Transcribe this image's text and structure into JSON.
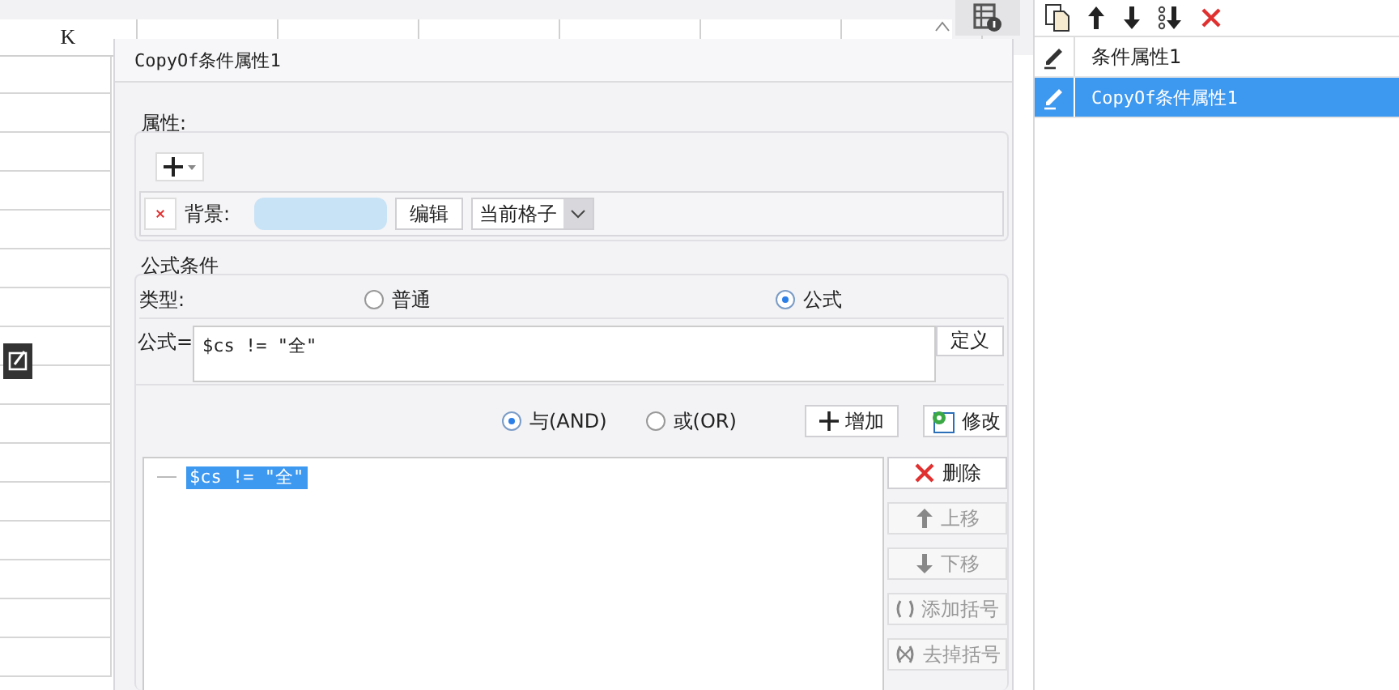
{
  "sheet": {
    "column_headers": [
      {
        "label": "K"
      }
    ]
  },
  "dialog": {
    "title": "CopyOf条件属性1",
    "attributes": {
      "label": "属性:",
      "items": [
        {
          "kind": "background",
          "label": "背景:",
          "color": "#c9e3f6",
          "edit_button": "编辑",
          "scope": "当前格子"
        }
      ]
    },
    "formula_condition": {
      "label": "公式条件",
      "type_label": "类型:",
      "types": [
        {
          "label": "普通",
          "selected": false
        },
        {
          "label": "公式",
          "selected": true
        }
      ],
      "formula_label": "公式=",
      "formula": "$cs != \"全\"",
      "define_button": "定义",
      "logic": [
        {
          "label": "与(AND)",
          "selected": true
        },
        {
          "label": "或(OR)",
          "selected": false
        }
      ],
      "add_button": "增加",
      "modify_button": "修改",
      "conditions": [
        {
          "text": "$cs != \"全\"",
          "selected": true
        }
      ],
      "actions": [
        {
          "kind": "delete",
          "label": "删除",
          "disabled": false
        },
        {
          "kind": "up",
          "label": "上移",
          "disabled": true
        },
        {
          "kind": "down",
          "label": "下移",
          "disabled": true
        },
        {
          "kind": "add-brackets",
          "label": "添加括号",
          "disabled": true
        },
        {
          "kind": "remove-brackets",
          "label": "去掉括号",
          "disabled": true
        }
      ]
    }
  },
  "panel": {
    "items": [
      {
        "label": "条件属性1",
        "selected": false
      },
      {
        "label": "CopyOf条件属性1",
        "selected": true
      }
    ]
  }
}
